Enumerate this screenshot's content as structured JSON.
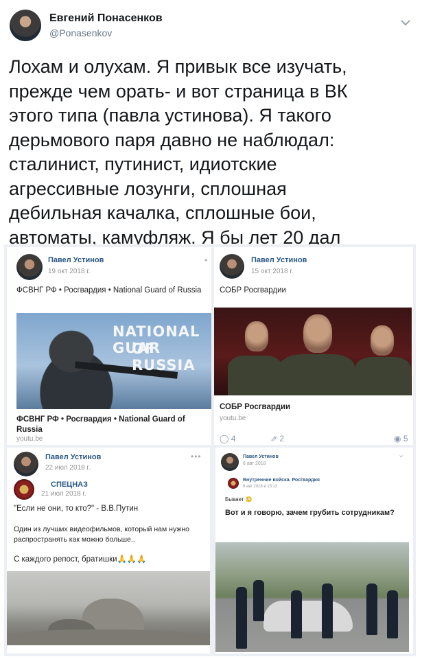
{
  "tweet": {
    "author_name": "Евгений Понасенков",
    "author_handle": "@Ponasenkov",
    "text": "Лохам и олухам. Я привык все изучать,\nпрежде чем орать- и вот страница  в ВК\nэтого типа (павла устинова). Я такого\nдерьмового паря давно не наблюдал:\nсталинист, путинист, идиотские\nагрессивные лозунги, сплошная\nдебильная качалка, сплошные бои,\nавтоматы, камуфляж. Я бы лет 20 дал",
    "menu_icon": "chevron-down-icon"
  },
  "embedded": {
    "post1": {
      "author": "Павел Устинов",
      "date": "19 окт 2018 г.",
      "text": "ФСВНГ РФ • Росгвардия • National Guard of Russia",
      "banner_line1": "NATIONAL GUAR",
      "banner_line2": "OF RUSSIA",
      "link_title": "ФСВНГ РФ • Росгвардия • National Guard of Russia",
      "link_domain": "youtu.be"
    },
    "post2": {
      "author": "Павел Устинов",
      "date": "15 окт 2018 г.",
      "text": "СОБР Росгвардии",
      "link_title": "СОБР Росгвардии",
      "link_domain": "youtu.be",
      "comments": "4",
      "reposts": "2",
      "views": "5"
    },
    "post3": {
      "author": "Павел Устинов",
      "date": "22 июл 2018 г.",
      "repost_source": "СПЕЦНАЗ",
      "repost_date": "21 июл 2018 г.",
      "quote": "\"Если не они, то кто?\" - В.В.Путин",
      "text": "Один из лучших видеофильмов, который нам нужно распространять как можно больше..",
      "footer": "С каждого репост, братишки🙏🙏🙏",
      "dots": "•••"
    },
    "post4": {
      "author": "Павел Устинов",
      "date": "6 авг 2018",
      "repost_source": "Внутренние войска. Росгвардия",
      "repost_date": "6 авг 2018 в 13:13",
      "short": "Бывает 😳",
      "headline": "Вот и я говорю, зачем грубить сотрудникам?"
    }
  }
}
